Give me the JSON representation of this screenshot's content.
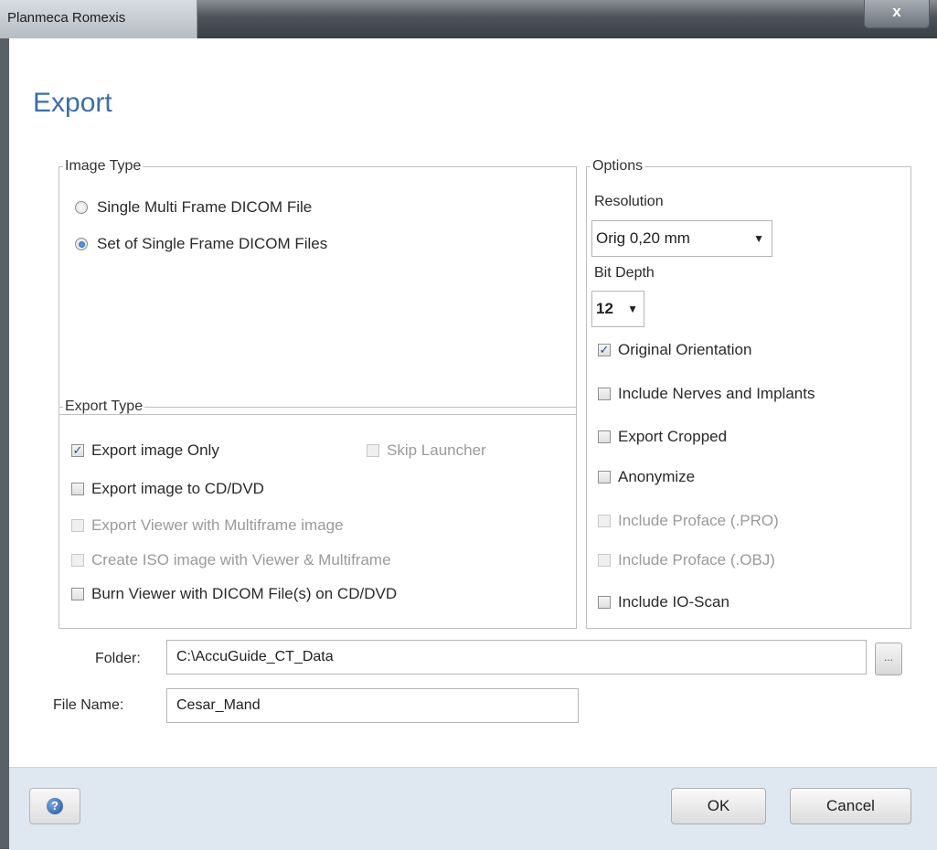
{
  "window": {
    "title": "Planmeca Romexis",
    "close_glyph": "x"
  },
  "dialog": {
    "heading": "Export"
  },
  "image_type": {
    "legend": "Image Type",
    "options": [
      {
        "label": "Single Multi Frame DICOM File",
        "selected": false
      },
      {
        "label": "Set of Single Frame DICOM Files",
        "selected": true
      }
    ]
  },
  "export_type": {
    "legend": "Export Type",
    "export_image_only": {
      "label": "Export image Only",
      "checked": true,
      "enabled": true
    },
    "skip_launcher": {
      "label": "Skip Launcher",
      "checked": false,
      "enabled": false
    },
    "export_to_cd": {
      "label": "Export image to CD/DVD",
      "checked": false,
      "enabled": true
    },
    "export_viewer_multiframe": {
      "label": "Export Viewer with Multiframe image",
      "checked": false,
      "enabled": false
    },
    "create_iso": {
      "label": "Create ISO image with Viewer & Multiframe",
      "checked": false,
      "enabled": false
    },
    "burn_viewer": {
      "label": "Burn Viewer with DICOM File(s) on CD/DVD",
      "checked": false,
      "enabled": true
    }
  },
  "options": {
    "legend": "Options",
    "resolution_label": "Resolution",
    "resolution_value": "Orig 0,20 mm",
    "bit_depth_label": "Bit Depth",
    "bit_depth_value": "12",
    "original_orientation": {
      "label": "Original Orientation",
      "checked": true,
      "enabled": true
    },
    "include_nerves": {
      "label": "Include Nerves and Implants",
      "checked": false,
      "enabled": true
    },
    "export_cropped": {
      "label": "Export Cropped",
      "checked": false,
      "enabled": true
    },
    "anonymize": {
      "label": "Anonymize",
      "checked": false,
      "enabled": true
    },
    "proface_pro": {
      "label": "Include Proface (.PRO)",
      "checked": false,
      "enabled": false
    },
    "proface_obj": {
      "label": "Include Proface (.OBJ)",
      "checked": false,
      "enabled": false
    },
    "io_scan": {
      "label": "Include IO-Scan",
      "checked": false,
      "enabled": true
    }
  },
  "folder": {
    "label": "Folder:",
    "value": "C:\\AccuGuide_CT_Data",
    "browse_label": "..."
  },
  "file_name": {
    "label": "File Name:",
    "value": "Cesar_Mand"
  },
  "footer": {
    "help_glyph": "?",
    "ok_label": "OK",
    "cancel_label": "Cancel"
  },
  "icons": {
    "checked": "check-mark",
    "dropdown": "triangle-down"
  }
}
